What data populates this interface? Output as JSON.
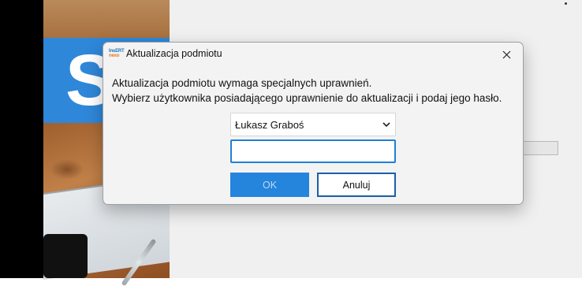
{
  "background": {
    "brand_letter": "S"
  },
  "dialog": {
    "title": "Aktualizacja podmiotu",
    "app_icon": {
      "line1": "InsERT",
      "line2": "nexo"
    },
    "close_icon": "close-icon",
    "message_line1": "Aktualizacja podmiotu wymaga specjalnych uprawnień.",
    "message_line2": "Wybierz użytkownika posiadającego uprawnienie do aktualizacji i podaj jego hasło.",
    "user_select": {
      "selected": "Łukasz Graboś"
    },
    "password": {
      "value": "",
      "placeholder": ""
    },
    "ok_label": "OK",
    "cancel_label": "Anuluj"
  },
  "colors": {
    "accent": "#2584db",
    "focus_border": "#1f7fd6",
    "brand_blue": "#2f87d9"
  }
}
